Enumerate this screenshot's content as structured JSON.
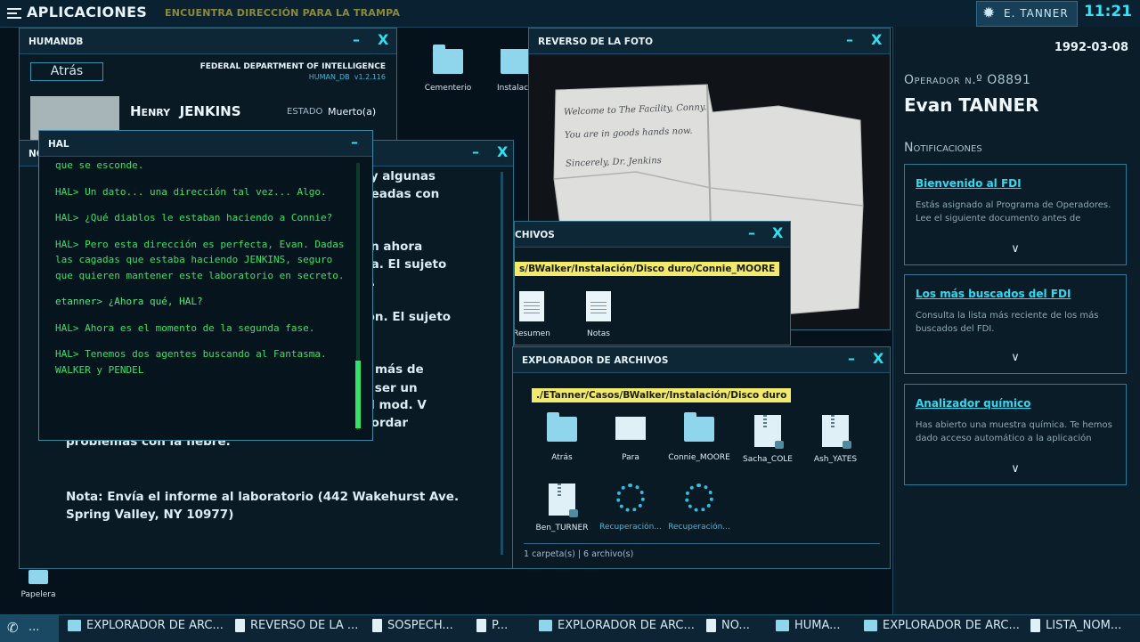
{
  "topbar": {
    "apps_label": "Aplicaciones",
    "objective": "Encuentra dirección para la trampa",
    "user": "E. TANNER",
    "clock": "11:21"
  },
  "desktop": {
    "icons": [
      {
        "label": "Cementerio"
      },
      {
        "label": "Instalaci"
      },
      {
        "label": "Papelera"
      }
    ]
  },
  "humandb": {
    "title": "HUMANDB",
    "back": "Atrás",
    "agency": "FEDERAL DEPARTMENT OF INTELLIGENCE",
    "app_name": "HUMAN_DB",
    "version": "v1.2.116",
    "first_name": "Henry",
    "last_name": "JENKINS",
    "status_label": "ESTADO",
    "status_value": "Muerto(a)"
  },
  "note_window": {
    "title": "NO",
    "fragments": [
      "ay algunas",
      "neadas con",
      "án ahora",
      "na. El sujeto",
      "e.",
      "ión. El sujeto",
      "ó más de",
      "a ser un",
      "el mod. V",
      "bordar",
      "problemas con la fiebre."
    ],
    "note_line1": "Nota: Envía el informe al laboratorio (442 Wakehurst Ave.",
    "note_line2": "Spring Valley, NY 10977)"
  },
  "hal": {
    "title": "HAL",
    "lines": [
      {
        "text": "que se esconde.",
        "user": false
      },
      {
        "text": "HAL> Un dato... una dirección tal vez... Algo.",
        "user": false
      },
      {
        "text": "HAL> ¿Qué diablos le estaban haciendo a Connie?",
        "user": false
      },
      {
        "text": "HAL> Pero esta dirección es perfecta, Evan. Dadas las cagadas que estaba haciendo JENKINS, seguro que quieren mantener este laboratorio en secreto.",
        "user": false
      },
      {
        "text": "etanner> ¿Ahora qué, HAL?",
        "user": true
      },
      {
        "text": "HAL> Ahora es el momento de la segunda fase.",
        "user": false
      },
      {
        "text": "HAL> Tenemos dos agentes buscando al Fantasma. WALKER y PENDEL",
        "user": false
      }
    ]
  },
  "photo_back": {
    "title": "REVERSO DE LA FOTO",
    "note_lines": [
      "Welcome to The Facility, Conny.",
      "You are in goods hands now.",
      "Sincerely, Dr. Jenkins"
    ]
  },
  "archive_small": {
    "title": "CHIVOS",
    "path": "s/BWalker/Instalación/Disco duro/Connie_MOORE",
    "files": [
      "Resumen",
      "Notas"
    ]
  },
  "explorer": {
    "title": "EXPLORADOR DE ARCHIVOS",
    "path": "./ETanner/Casos/BWalker/Instalación/Disco duro",
    "items": [
      "Atrás",
      "Para",
      "Connie_MOORE",
      "Sacha_COLE",
      "Ash_YATES",
      "Ben_TURNER",
      "Recuperación...",
      "Recuperación..."
    ],
    "status": "1 carpeta(s) | 6 archivo(s)"
  },
  "right_panel": {
    "date": "1992-03-08",
    "operator_label": "Operador n.º O8891",
    "operator_name": "Evan TANNER",
    "notifications_label": "Notificaciones",
    "notifications": [
      {
        "title": "Bienvenido al FDI",
        "body": "Estás asignado al Programa de Operadores. Lee el siguiente documento antes de continuar."
      },
      {
        "title": "Los más buscados del FDI",
        "body": "Consulta la lista más reciente de los más buscados del FDI."
      },
      {
        "title": "Analizador químico",
        "body": "Has abierto una muestra química. Te hemos dado acceso automático a la aplicación Informe de datos CELCA. La"
      }
    ]
  },
  "taskbar": {
    "start": "...",
    "items": [
      "EXPLORADOR DE ARC...",
      "REVERSO DE LA ...",
      "SOSPECH...",
      "P...",
      "EXPLORADOR DE ARC...",
      "NO...",
      "HUMA...",
      "EXPLORADOR DE ARC...",
      "LISTA_NOM..."
    ]
  },
  "colors": {
    "accent": "#2ee0f0",
    "terminal_green": "#38e06a",
    "path_highlight": "#f1ea6a"
  }
}
